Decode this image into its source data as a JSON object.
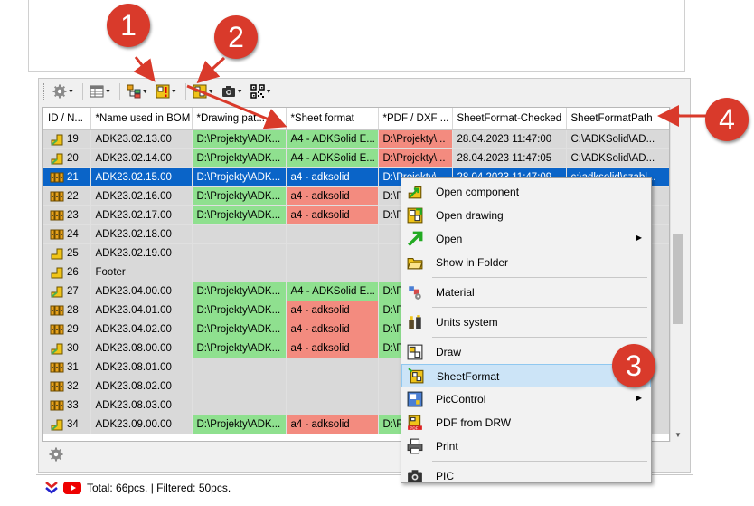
{
  "toolbar": {
    "items": [
      "gear-icon",
      "table-icon",
      "tree-icon",
      "drawing-warning-icon",
      "drawing-icon",
      "camera-icon",
      "qr-code-icon"
    ]
  },
  "grid": {
    "columns": [
      "ID / N...",
      "*Name used in BOM",
      "*Drawing pat...",
      "*Sheet format",
      "*PDF / DXF ...",
      "SheetFormat-Checked",
      "SheetFormatPath"
    ],
    "rows": [
      {
        "id": "19",
        "name": "ADK23.02.13.00",
        "drawing": "D:\\Projekty\\ADK...",
        "sheet": "A4 - ADKSolid E...",
        "pdf": "D:\\Projekty\\...",
        "checked": "28.04.2023 11:47:00",
        "path": "C:\\ADKSolid\\AD...",
        "cls": [
          "",
          "",
          "green",
          "green",
          "red",
          "",
          ""
        ]
      },
      {
        "id": "20",
        "name": "ADK23.02.14.00",
        "drawing": "D:\\Projekty\\ADK...",
        "sheet": "A4 - ADKSolid E...",
        "pdf": "D:\\Projekty\\...",
        "checked": "28.04.2023 11:47:05",
        "path": "C:\\ADKSolid\\AD...",
        "cls": [
          "",
          "",
          "green",
          "green",
          "red",
          "",
          ""
        ]
      },
      {
        "id": "21",
        "name": "ADK23.02.15.00",
        "drawing": "D:\\Projekty\\ADK...",
        "sheet": "a4 - adksolid",
        "pdf": "D:\\Projekty\\...",
        "checked": "28.04.2023 11:47:09",
        "path": "c:\\adksolid\\szabl...",
        "cls": [
          "",
          "",
          "",
          "",
          "",
          "",
          ""
        ],
        "selected": true
      },
      {
        "id": "22",
        "name": "ADK23.02.16.00",
        "drawing": "D:\\Projekty\\ADK...",
        "sheet": "a4 - adksolid",
        "pdf": "D:\\P",
        "checked": "",
        "path": "",
        "cls": [
          "",
          "",
          "green",
          "red",
          "",
          "",
          ""
        ]
      },
      {
        "id": "23",
        "name": "ADK23.02.17.00",
        "drawing": "D:\\Projekty\\ADK...",
        "sheet": "a4 - adksolid",
        "pdf": "D:\\P",
        "checked": "",
        "path": "",
        "cls": [
          "",
          "",
          "green",
          "red",
          "",
          "",
          ""
        ]
      },
      {
        "id": "24",
        "name": "ADK23.02.18.00",
        "drawing": "",
        "sheet": "",
        "pdf": "",
        "checked": "",
        "path": "",
        "cls": [
          "",
          "",
          "",
          "",
          "",
          "",
          ""
        ]
      },
      {
        "id": "25",
        "name": "ADK23.02.19.00",
        "drawing": "",
        "sheet": "",
        "pdf": "",
        "checked": "",
        "path": "",
        "cls": [
          "",
          "",
          "",
          "",
          "",
          "",
          ""
        ]
      },
      {
        "id": "26",
        "name": "Footer",
        "drawing": "",
        "sheet": "",
        "pdf": "",
        "checked": "",
        "path": "",
        "cls": [
          "",
          "",
          "",
          "",
          "",
          "",
          ""
        ]
      },
      {
        "id": "27",
        "name": "ADK23.04.00.00",
        "drawing": "D:\\Projekty\\ADK...",
        "sheet": "A4 - ADKSolid E...",
        "pdf": "D:\\P",
        "checked": "",
        "path": "",
        "cls": [
          "",
          "",
          "green",
          "green",
          "green",
          "",
          ""
        ]
      },
      {
        "id": "28",
        "name": "ADK23.04.01.00",
        "drawing": "D:\\Projekty\\ADK...",
        "sheet": "a4 - adksolid",
        "pdf": "D:\\P",
        "checked": "",
        "path": "",
        "cls": [
          "",
          "",
          "green",
          "red",
          "green",
          "",
          ""
        ]
      },
      {
        "id": "29",
        "name": "ADK23.04.02.00",
        "drawing": "D:\\Projekty\\ADK...",
        "sheet": "a4 - adksolid",
        "pdf": "D:\\P",
        "checked": "",
        "path": "",
        "cls": [
          "",
          "",
          "green",
          "red",
          "green",
          "",
          ""
        ]
      },
      {
        "id": "30",
        "name": "ADK23.08.00.00",
        "drawing": "D:\\Projekty\\ADK...",
        "sheet": "a4 - adksolid",
        "pdf": "D:\\P",
        "checked": "",
        "path": "",
        "cls": [
          "",
          "",
          "green",
          "red",
          "green",
          "",
          ""
        ]
      },
      {
        "id": "31",
        "name": "ADK23.08.01.00",
        "drawing": "",
        "sheet": "",
        "pdf": "",
        "checked": "",
        "path": "",
        "cls": [
          "",
          "",
          "",
          "",
          "",
          "",
          ""
        ]
      },
      {
        "id": "32",
        "name": "ADK23.08.02.00",
        "drawing": "",
        "sheet": "",
        "pdf": "",
        "checked": "",
        "path": "",
        "cls": [
          "",
          "",
          "",
          "",
          "",
          "",
          ""
        ]
      },
      {
        "id": "33",
        "name": "ADK23.08.03.00",
        "drawing": "",
        "sheet": "",
        "pdf": "",
        "checked": "",
        "path": "",
        "cls": [
          "",
          "",
          "",
          "",
          "",
          "",
          ""
        ]
      },
      {
        "id": "34",
        "name": "ADK23.09.00.00",
        "drawing": "D:\\Projekty\\ADK...",
        "sheet": "a4 - adksolid",
        "pdf": "D:\\F",
        "checked": "",
        "path": "",
        "cls": [
          "",
          "",
          "green",
          "red",
          "green",
          "",
          ""
        ]
      }
    ]
  },
  "status": {
    "text": "Total: 66pcs. | Filtered: 50pcs."
  },
  "context_menu": {
    "items": [
      {
        "label": "Open component",
        "icon": "open-component-icon"
      },
      {
        "label": "Open drawing",
        "icon": "open-drawing-icon"
      },
      {
        "label": "Open",
        "icon": "open-arrow-icon",
        "submenu": true
      },
      {
        "label": "Show in Folder",
        "icon": "folder-icon"
      },
      {
        "sep": true
      },
      {
        "label": "Material",
        "icon": "material-icon"
      },
      {
        "sep": true
      },
      {
        "label": "Units system",
        "icon": "units-icon"
      },
      {
        "sep": true
      },
      {
        "label": "Draw",
        "icon": "draw-icon"
      },
      {
        "label": "SheetFormat",
        "icon": "sheetformat-icon",
        "highlight": true
      },
      {
        "label": "PicControl",
        "icon": "piccontrol-icon",
        "submenu": true
      },
      {
        "label": "PDF from DRW",
        "icon": "pdf-icon"
      },
      {
        "label": "Print",
        "icon": "printer-icon"
      },
      {
        "sep": true
      },
      {
        "label": "PIC",
        "icon": "camera-icon"
      }
    ]
  },
  "callouts": [
    "1",
    "2",
    "3",
    "4"
  ],
  "colors": {
    "green": "#8fe08f",
    "red": "#f38b7f",
    "selected": "#0a64c8",
    "callout": "#d93a2b"
  }
}
